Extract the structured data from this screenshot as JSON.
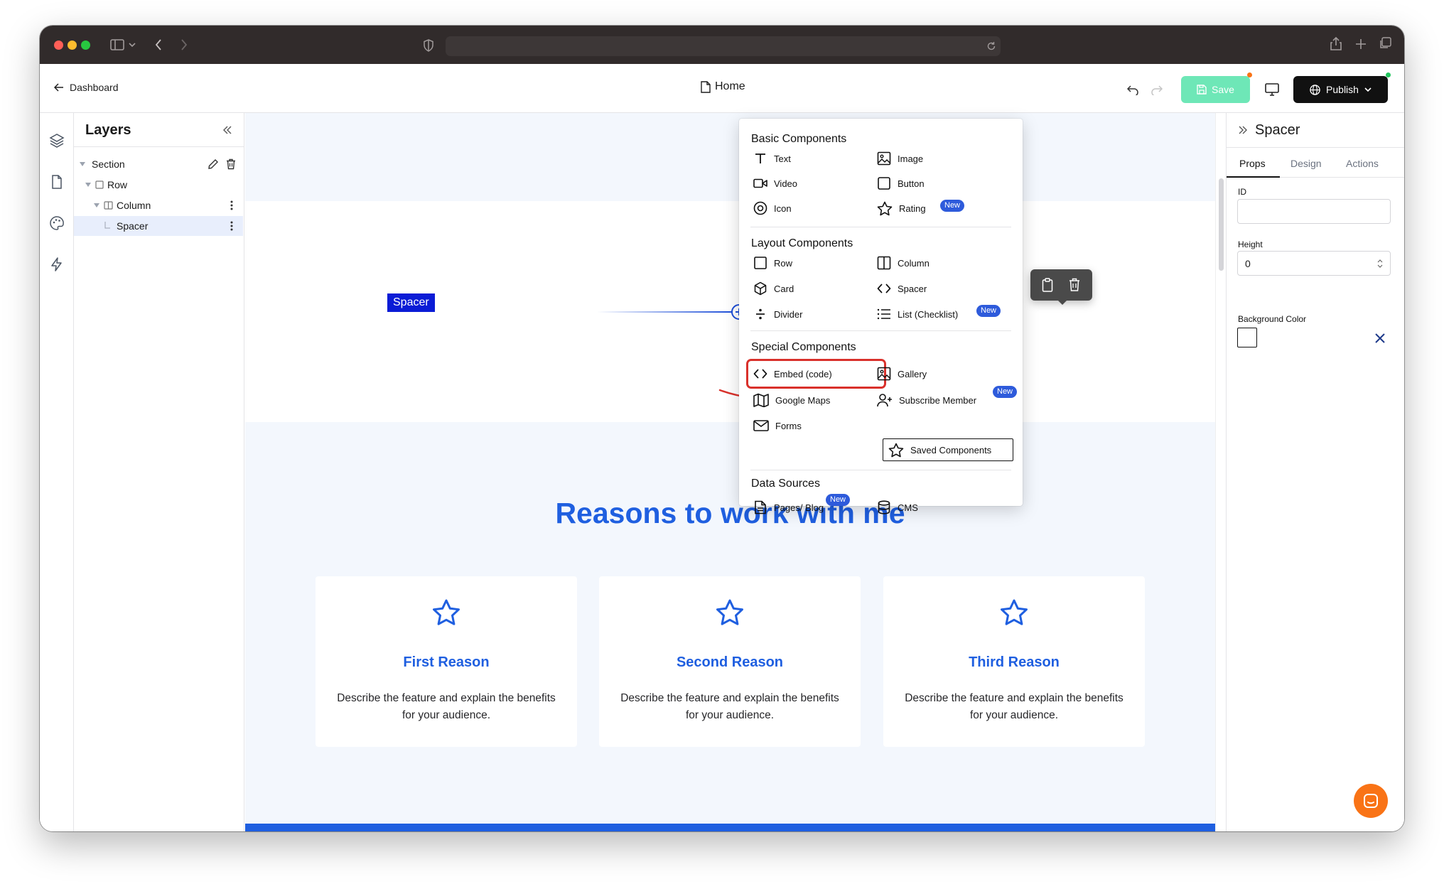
{
  "header": {
    "back_label": "Dashboard",
    "page_title": "Home",
    "save_label": "Save",
    "publish_label": "Publish"
  },
  "layers": {
    "title": "Layers",
    "items": [
      {
        "label": "Section"
      },
      {
        "label": "Row"
      },
      {
        "label": "Column"
      },
      {
        "label": "Spacer"
      }
    ]
  },
  "canvas": {
    "spacer_tag": "Spacer",
    "heading": "Reasons to work with me",
    "cards": [
      {
        "title": "First Reason",
        "description": "Describe the feature and explain the benefits for your audience."
      },
      {
        "title": "Second Reason",
        "description": "Describe the feature and explain the benefits for your audience."
      },
      {
        "title": "Third Reason",
        "description": "Describe the feature and explain the benefits for your audience."
      }
    ]
  },
  "menu": {
    "sections": {
      "basic": "Basic Components",
      "layout": "Layout Components",
      "special": "Special Components",
      "data": "Data Sources"
    },
    "basic": {
      "text": "Text",
      "image": "Image",
      "video": "Video",
      "button": "Button",
      "icon": "Icon",
      "rating": "Rating"
    },
    "layout": {
      "row": "Row",
      "column": "Column",
      "card": "Card",
      "spacer": "Spacer",
      "divider": "Divider",
      "list": "List (Checklist)"
    },
    "special": {
      "embed": "Embed (code)",
      "gallery": "Gallery",
      "maps": "Google Maps",
      "subscribe": "Subscribe Member",
      "forms": "Forms",
      "saved": "Saved Components"
    },
    "data": {
      "pages": "Pages/ Blog",
      "cms": "CMS"
    },
    "badge_new": "New"
  },
  "right_panel": {
    "title": "Spacer",
    "tabs": [
      "Props",
      "Design",
      "Actions"
    ],
    "active_tab": "Props",
    "id_label": "ID",
    "id_value": "",
    "height_label": "Height",
    "height_value": "0",
    "bg_label": "Background Color"
  },
  "colors": {
    "accent": "#1f5fe0",
    "save": "#6ee7b7",
    "badge": "#2e5bdb",
    "highlight": "#d9312b",
    "chat": "#f97316"
  }
}
